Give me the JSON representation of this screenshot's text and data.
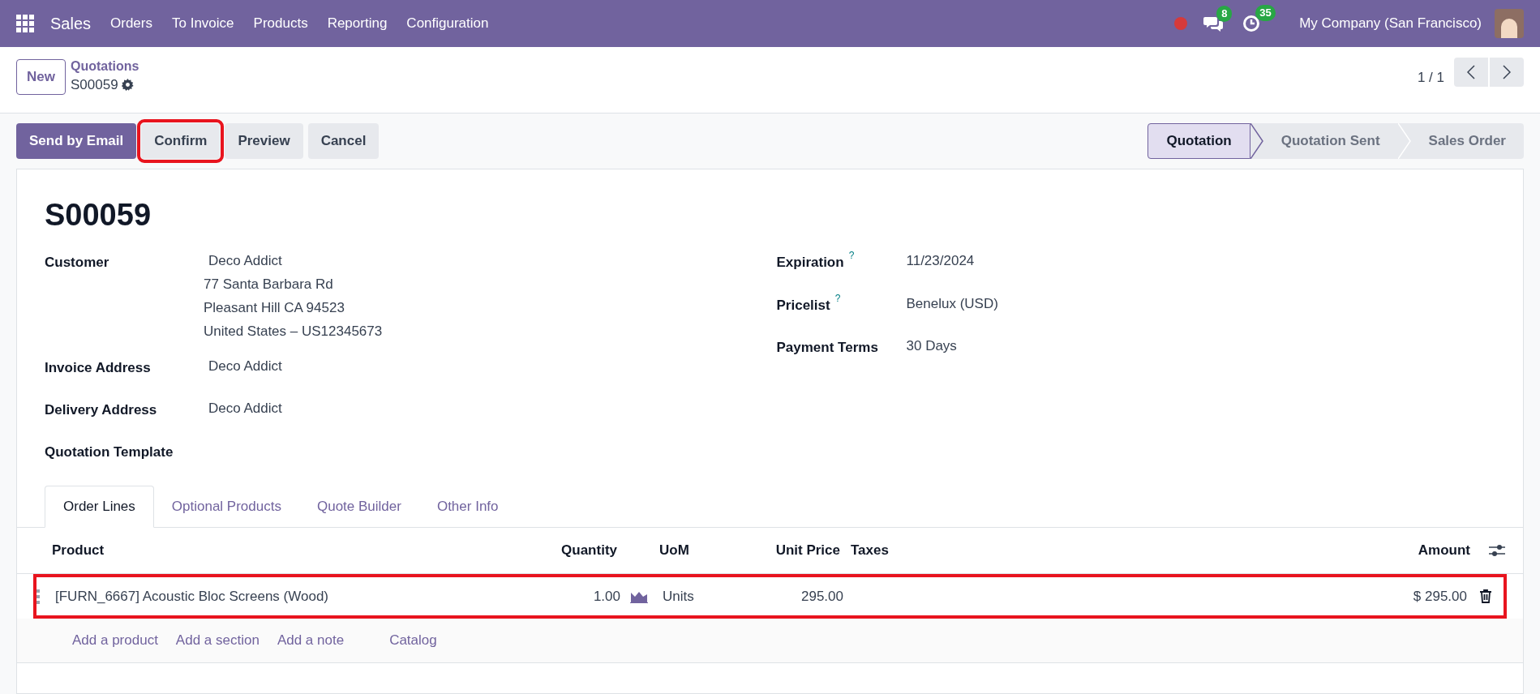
{
  "navbar": {
    "app": "Sales",
    "menu": [
      "Orders",
      "To Invoice",
      "Products",
      "Reporting",
      "Configuration"
    ],
    "messages_count": "8",
    "activities_count": "35",
    "company": "My Company (San Francisco)"
  },
  "control_panel": {
    "new_button": "New",
    "breadcrumb": "Quotations",
    "record": "S00059",
    "pager": "1 / 1"
  },
  "actions": [
    {
      "label": "Send by Email",
      "kind": "primary",
      "highlighted": false
    },
    {
      "label": "Confirm",
      "kind": "secondary",
      "highlighted": true
    },
    {
      "label": "Preview",
      "kind": "secondary",
      "highlighted": false
    },
    {
      "label": "Cancel",
      "kind": "secondary",
      "highlighted": false
    }
  ],
  "statusbar": [
    {
      "label": "Quotation",
      "selected": true
    },
    {
      "label": "Quotation Sent",
      "selected": false
    },
    {
      "label": "Sales Order",
      "selected": false
    }
  ],
  "form": {
    "title": "S00059",
    "left_fields": [
      {
        "label": "Customer",
        "values": [
          "Deco Addict",
          "77 Santa Barbara Rd",
          "Pleasant Hill CA 94523",
          "United States – US12345673"
        ]
      },
      {
        "label": "Invoice Address",
        "values": [
          "Deco Addict"
        ]
      },
      {
        "label": "Delivery Address",
        "values": [
          "Deco Addict"
        ]
      },
      {
        "label": "Quotation Template"
      }
    ],
    "right_fields": [
      {
        "label": "Expiration",
        "help": "?",
        "value": "11/23/2024"
      },
      {
        "label": "Pricelist",
        "help": "?",
        "value": "Benelux (USD)"
      },
      {
        "label": "Payment Terms",
        "value": "30 Days"
      }
    ]
  },
  "tabs": [
    {
      "label": "Order Lines",
      "selected": true
    },
    {
      "label": "Optional Products",
      "selected": false
    },
    {
      "label": "Quote Builder",
      "selected": false
    },
    {
      "label": "Other Info",
      "selected": false
    }
  ],
  "table": {
    "columns": [
      "Product",
      "Quantity",
      "UoM",
      "Unit Price",
      "Taxes",
      "Amount"
    ],
    "rows": [
      {
        "product": "[FURN_6667] Acoustic Bloc Screens (Wood)",
        "quantity": "1.00",
        "uom": "Units",
        "unit_price": "295.00",
        "amount": "$ 295.00",
        "highlighted": true
      }
    ],
    "add_links": [
      "Add a product",
      "Add a section",
      "Add a note",
      "Catalog"
    ]
  }
}
